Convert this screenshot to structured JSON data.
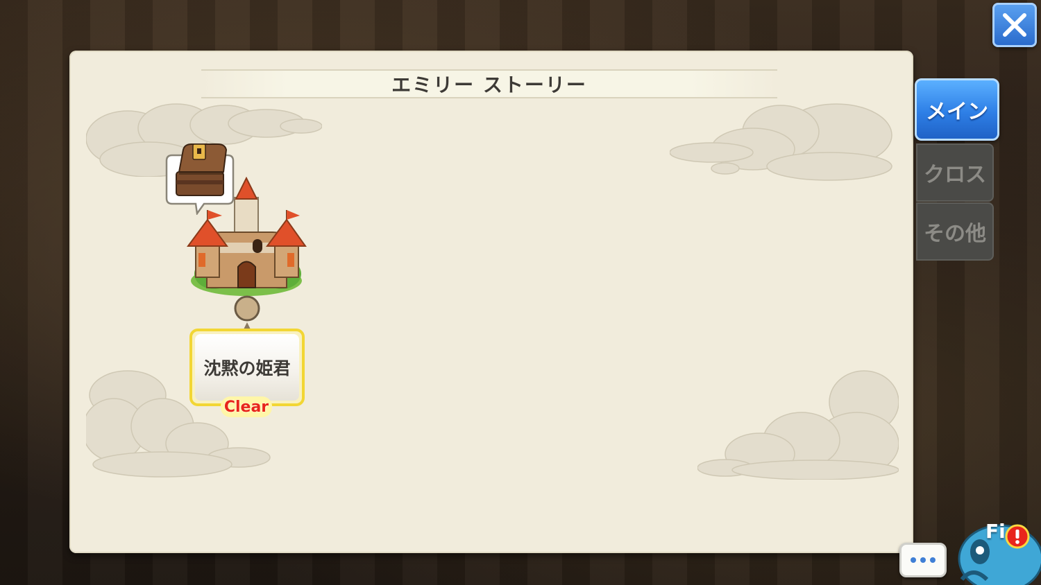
{
  "window": {
    "title": "エミリー ストーリー"
  },
  "tabs": [
    {
      "label": "メイン",
      "active": true
    },
    {
      "label": "クロス",
      "active": false
    },
    {
      "label": "その他",
      "active": false
    }
  ],
  "stage": {
    "name": "沈黙の姫君",
    "status": "Clear"
  },
  "field_button": {
    "label": "Fi"
  },
  "icons": {
    "close": "close-icon",
    "chest": "treasure-chest-icon",
    "castle": "castle-icon",
    "chat": "chat-bubble-icon",
    "alert": "alert-icon"
  },
  "colors": {
    "accent": "#2e7fe6",
    "panel": "#f1ecdc",
    "clear": "#e8251c",
    "card_border": "#f2d634"
  }
}
